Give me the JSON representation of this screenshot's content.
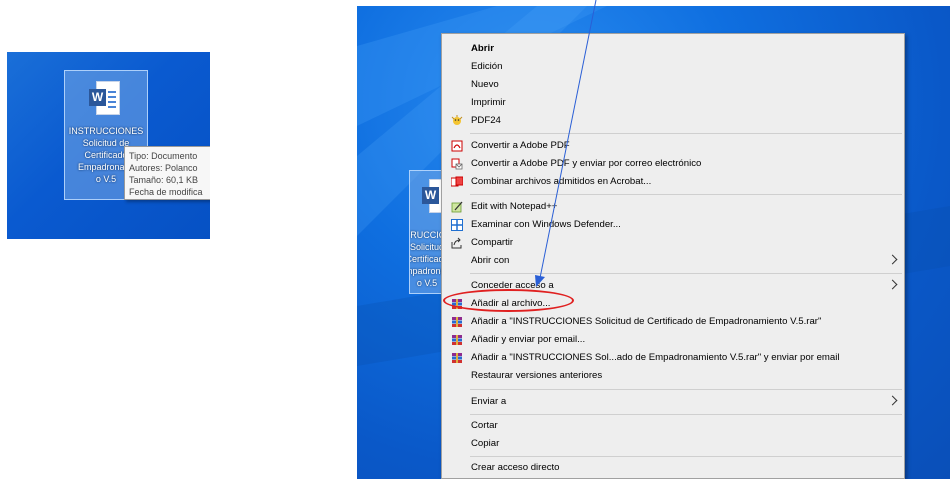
{
  "left_crop": {
    "icon_label": [
      "INSTRUCCIONES",
      "Solicitud de",
      "Certificado",
      "Empadronami",
      "o V.5"
    ],
    "tooltip": [
      "Tipo: Documento",
      "Autores: Polanco",
      "Tamaño: 60,1 KB",
      "Fecha de modifica"
    ]
  },
  "right_crop": {
    "icon_label": [
      "INSTRUCCIONES",
      "Solicitud",
      "Certificado",
      "Empadronami",
      "o V.5"
    ]
  },
  "context_menu": {
    "items": [
      {
        "label": "Abrir",
        "bold": true
      },
      {
        "label": "Edición"
      },
      {
        "label": "Nuevo"
      },
      {
        "label": "Imprimir"
      },
      {
        "label": "PDF24",
        "icon": "pdf24-icon"
      },
      {
        "label": "Convertir a Adobe PDF",
        "icon": "adobe-pdf-icon"
      },
      {
        "label": "Convertir a Adobe PDF y enviar por correo electrónico",
        "icon": "adobe-pdf-mail-icon"
      },
      {
        "label": "Combinar archivos admitidos en Acrobat...",
        "icon": "acrobat-combine-icon"
      },
      {
        "label": "Edit with Notepad++",
        "icon": "notepadpp-icon"
      },
      {
        "label": "Examinar con Windows Defender...",
        "icon": "windows-defender-icon"
      },
      {
        "label": "Compartir",
        "icon": "share-icon"
      },
      {
        "label": "Abrir con",
        "submenu": true
      },
      {
        "label": "Conceder acceso a",
        "submenu": true
      },
      {
        "label": "Añadir al archivo...",
        "icon": "winrar-icon"
      },
      {
        "label": "Añadir a \"INSTRUCCIONES Solicitud de Certificado de Empadronamiento V.5.rar\"",
        "icon": "winrar-icon"
      },
      {
        "label": "Añadir y enviar por email...",
        "icon": "winrar-icon"
      },
      {
        "label": "Añadir a \"INSTRUCCIONES Sol...ado de Empadronamiento V.5.rar\" y enviar por email",
        "icon": "winrar-icon"
      },
      {
        "label": "Restaurar versiones anteriores"
      },
      {
        "label": "Enviar a",
        "submenu": true
      },
      {
        "label": "Cortar"
      },
      {
        "label": "Copiar"
      },
      {
        "label": "Crear acceso directo"
      }
    ]
  },
  "colors": {
    "desktop_blue": "#0a5ad0",
    "annotation_arrow": "#2a5fd6",
    "highlight_circle": "#e02020",
    "word_blue": "#2b579a"
  }
}
